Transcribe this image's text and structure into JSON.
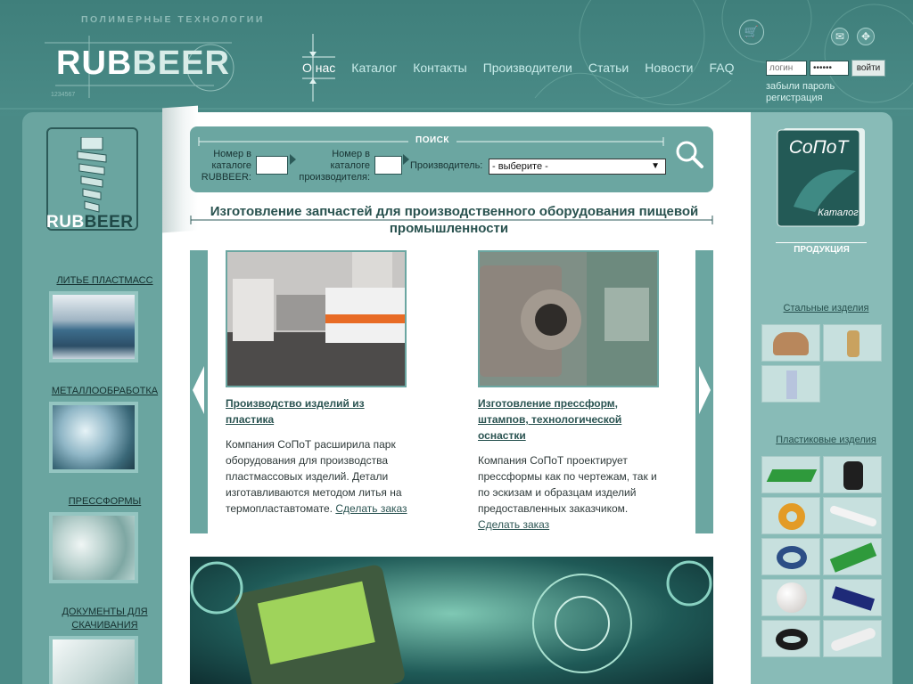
{
  "header": {
    "tagline": "ПОЛИМЕРНЫЕ ТЕХНОЛОГИИ",
    "logo_rub": "RUB",
    "logo_beer": "BEER",
    "logo_number": "1234567",
    "nav": [
      "О нас",
      "Каталог",
      "Контакты",
      "Производители",
      "Статьи",
      "Новости",
      "FAQ"
    ],
    "active_nav": "О нас",
    "login_placeholder": "логин",
    "password_value": "••••••",
    "login_button": "войти",
    "forgot_password": "забыли пароль",
    "register": "регистрация",
    "icons": [
      "cart-icon",
      "mail-icon",
      "compass-icon"
    ]
  },
  "left_sidebar": {
    "logo_rub": "RUB",
    "logo_beer": "BEER",
    "categories": [
      {
        "label": "ЛИТЬЕ ПЛАСТМАСС"
      },
      {
        "label": "МЕТАЛЛООБРАБОТКА"
      },
      {
        "label": "ПРЕССФОРМЫ"
      },
      {
        "label": "ДОКУМЕНТЫ ДЛЯ СКАЧИВАНИЯ"
      }
    ]
  },
  "search": {
    "title": "ПОИСК",
    "catalog_number_label": "Номер в каталоге RUBBEER:",
    "producer_number_label": "Номер в каталоге производителя:",
    "producer_label": "Производитель:",
    "producer_selected": "- выберите -"
  },
  "main": {
    "heading": "Изготовление запчастей для производственного оборудования пищевой промышленности",
    "cards": [
      {
        "title": "Производство изделий из пластика",
        "text": "Компания СоПоТ расширила парк оборудования для производства пластмассовых изделий. Детали изготавливаются методом литья на термопластавтомате.",
        "link": "Сделать заказ"
      },
      {
        "title": "Изготовление прессформ, штампов, технологической оснастки",
        "text": "Компания СоПоТ проектирует прессформы как по чертежам, так и по эскизам и образцам изделий предоставленных заказчиком.",
        "link": "Сделать заказ"
      }
    ]
  },
  "right_sidebar": {
    "catalog_brand": "СоПоТ",
    "catalog_label": "Каталог",
    "products_label": "ПРОДУКЦИЯ",
    "steel_label": "Стальные изделия",
    "plastic_label": "Пластиковые изделия"
  },
  "colors": {
    "page_bg": "#4a8a86",
    "panel": "#6ba6a1",
    "right_panel": "#88bbb7",
    "text_dark": "#29524f"
  }
}
